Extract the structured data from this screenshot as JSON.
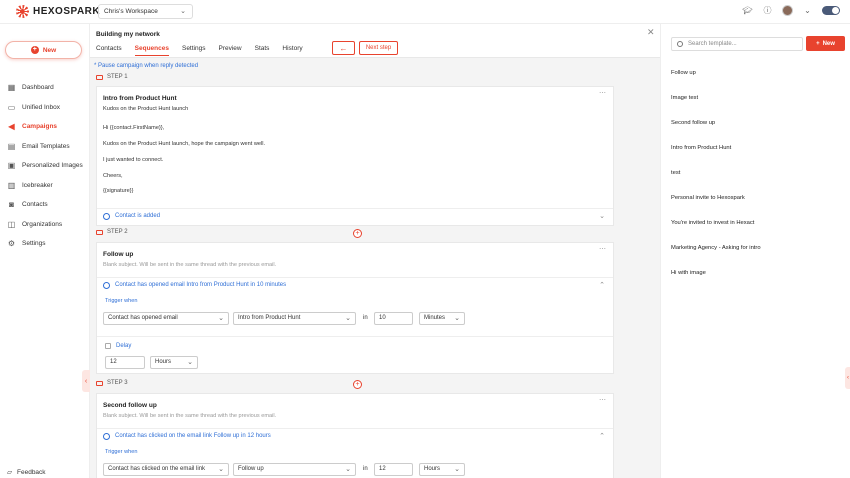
{
  "app": {
    "brand": "HEXOSPARK",
    "workspace": "Chris's Workspace"
  },
  "icons": {
    "academy": "graduation-cap-icon",
    "help": "help-icon",
    "feedback": "feedback-icon"
  },
  "colors": {
    "accent": "#e8432e",
    "link": "#2f6fd6"
  },
  "sidebar": {
    "new_label": "New",
    "items": [
      {
        "label": "Dashboard",
        "icon": "dashboard-icon",
        "glyph": "▦"
      },
      {
        "label": "Unified Inbox",
        "icon": "inbox-icon",
        "glyph": "▭"
      },
      {
        "label": "Campaigns",
        "icon": "megaphone-icon",
        "glyph": "◀"
      },
      {
        "label": "Email Templates",
        "icon": "template-icon",
        "glyph": "▤"
      },
      {
        "label": "Personalized Images",
        "icon": "image-icon",
        "glyph": "▣"
      },
      {
        "label": "Icebreaker",
        "icon": "icebreaker-icon",
        "glyph": "▥"
      },
      {
        "label": "Contacts",
        "icon": "contacts-icon",
        "glyph": "◙"
      },
      {
        "label": "Organizations",
        "icon": "organizations-icon",
        "glyph": "◫"
      },
      {
        "label": "Settings",
        "icon": "gear-icon",
        "glyph": "⚙"
      }
    ],
    "feedback_label": "Feedback"
  },
  "header": {
    "title": "Building my network",
    "tabs": [
      "Contacts",
      "Sequences",
      "Settings",
      "Preview",
      "Stats",
      "History"
    ],
    "active_tab": "Sequences",
    "back_label": "←",
    "next_label": "Next step"
  },
  "main": {
    "pause_link": "* Pause campaign when reply detected",
    "step1": {
      "label": "STEP 1",
      "subject": "Intro from Product Hunt",
      "body": [
        "Kudos on the Product Hunt launch",
        "Hi {{contact.FirstName}},",
        "Kudos on the Product Hunt launch, hope the campaign went well.",
        "I just wanted to connect.",
        "Cheers,",
        "{{signature}}"
      ],
      "condition": "Contact is added"
    },
    "step2": {
      "label": "STEP 2",
      "subject": "Follow up",
      "note": "Blank subject. Will be sent in the same thread with the previous email.",
      "condition": "Contact has opened email Intro from Product Hunt in 10 minutes",
      "trigger_label": "Trigger when",
      "trigger_event": "Contact has opened email",
      "trigger_email": "Intro from Product Hunt",
      "in_label": "in",
      "amount": "10",
      "unit": "Minutes",
      "delay_label": "Delay",
      "delay_amount": "12",
      "delay_unit": "Hours"
    },
    "step3": {
      "label": "STEP 3",
      "subject": "Second follow up",
      "note": "Blank subject. Will be sent in the same thread with the previous email.",
      "condition": "Contact has clicked on the email link Follow up in 12 hours",
      "trigger_label": "Trigger when",
      "trigger_event": "Contact has clicked on the email link",
      "trigger_email": "Follow up",
      "in_label": "in",
      "amount": "12",
      "unit": "Hours"
    }
  },
  "right_panel": {
    "search_placeholder": "Search template...",
    "new_label": "New",
    "templates": [
      "Follow up",
      "Image test",
      "Second follow up",
      "Intro from Product Hunt",
      "test",
      "Personal invite to Hexospark",
      "You're invited to invest in Hexact",
      "Marketing Agency - Asking for intro",
      "Hi with image"
    ]
  }
}
